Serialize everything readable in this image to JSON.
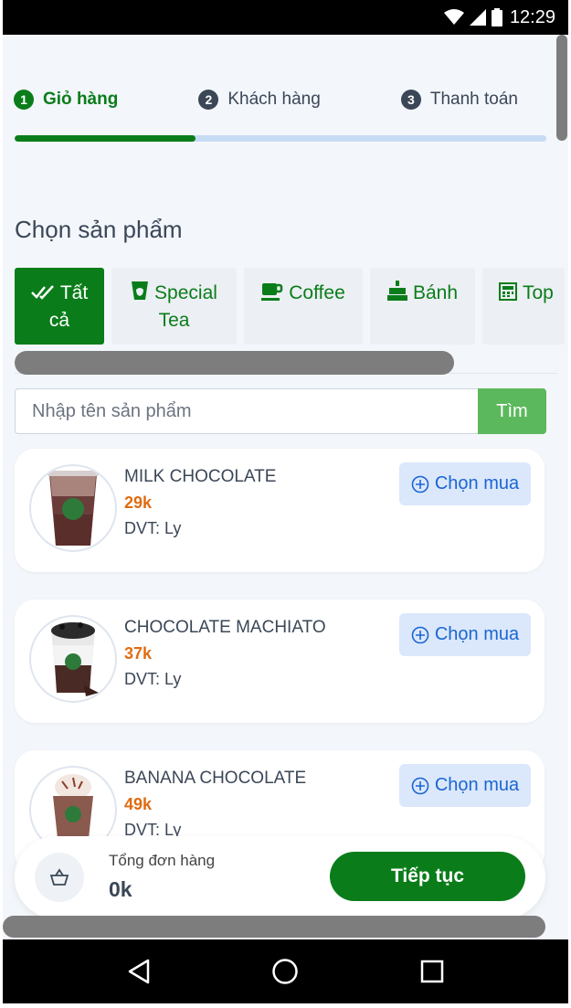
{
  "status_bar": {
    "time": "12:29"
  },
  "steps": [
    {
      "num": "1",
      "label": "Giỏ hàng"
    },
    {
      "num": "2",
      "label": "Khách hàng"
    },
    {
      "num": "3",
      "label": "Thanh toán"
    }
  ],
  "progress_fraction": 0.34,
  "section_title": "Chọn sản phẩm",
  "categories": [
    {
      "label_line1": "Tất",
      "label_line2": "cả",
      "icon": "double-check-icon",
      "active": true
    },
    {
      "label_line1": "Special",
      "label_line2": "Tea",
      "icon": "cup-icon"
    },
    {
      "label_line1": "Coffee",
      "label_line2": "",
      "icon": "coffee-icon"
    },
    {
      "label_line1": "Bánh",
      "label_line2": "",
      "icon": "cake-icon"
    },
    {
      "label_line1": "Top",
      "label_line2": "",
      "icon": "topping-icon"
    }
  ],
  "search": {
    "placeholder": "Nhập tên sản phẩm",
    "button": "Tìm"
  },
  "products": [
    {
      "name": "MILK CHOCOLATE",
      "price": "29k",
      "unit": "DVT: Ly",
      "buy_label": "Chọn mua"
    },
    {
      "name": "CHOCOLATE MACHIATO",
      "price": "37k",
      "unit": "DVT: Ly",
      "buy_label": "Chọn mua"
    },
    {
      "name": "BANANA CHOCOLATE",
      "price": "49k",
      "unit": "DVT: Ly",
      "buy_label": "Chọn mua"
    }
  ],
  "footer": {
    "label": "Tổng đơn hàng",
    "total": "0k",
    "continue": "Tiếp tục"
  },
  "colors": {
    "primary": "#0a7d1a",
    "price": "#e06c12",
    "buy_bg": "#dbe7fb",
    "buy_text": "#1a66d2",
    "search_button": "#5cb85c"
  }
}
